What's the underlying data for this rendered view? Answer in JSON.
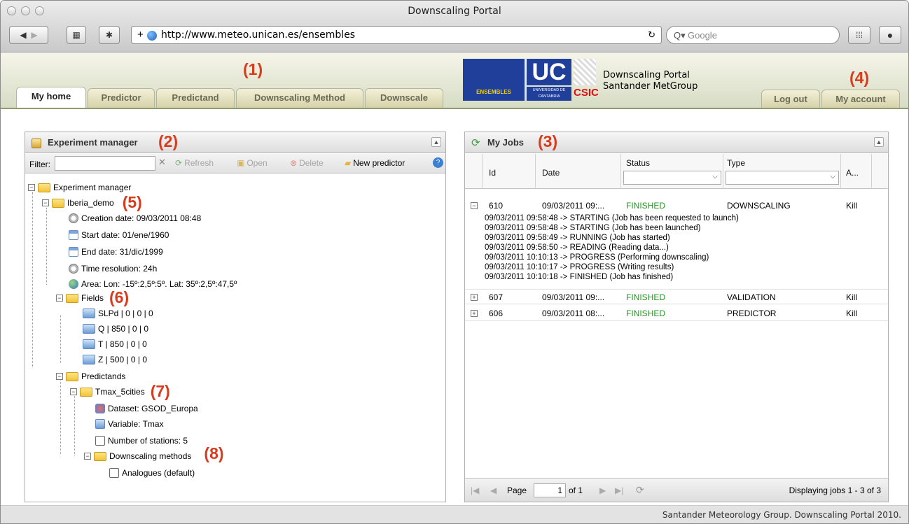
{
  "window": {
    "title": "Downscaling Portal"
  },
  "browser": {
    "url": "http://www.meteo.unican.es/ensembles",
    "search_placeholder": "Google"
  },
  "callouts": {
    "c1": "(1)",
    "c2": "(2)",
    "c3": "(3)",
    "c4": "(4)",
    "c5": "(5)",
    "c6": "(6)",
    "c7": "(7)",
    "c8": "(8)"
  },
  "nav": {
    "tabs": [
      "My home",
      "Predictor",
      "Predictand",
      "Downscaling Method",
      "Downscale"
    ],
    "right_tabs": [
      "Log out",
      "My account"
    ]
  },
  "logos": {
    "ensembles": "ENSEMBLES",
    "uc": "UC",
    "uc_sub": "UNIVERSIDAD DE CANTABRIA",
    "csic": "CSIC"
  },
  "brand": {
    "line1": "Downscaling Portal",
    "line2": "Santander MetGroup"
  },
  "experiment_manager": {
    "title": "Experiment manager",
    "filter_label": "Filter:",
    "refresh": "Refresh",
    "open": "Open",
    "delete": "Delete",
    "new_predictor": "New predictor",
    "tree": {
      "root": "Experiment manager",
      "iberia": "Iberia_demo",
      "creation": "Creation date: 09/03/2011 08:48",
      "start": "Start date: 01/ene/1960",
      "end": "End date: 31/dic/1999",
      "resolution": "Time resolution: 24h",
      "area": "Area: Lon: -15º:2,5º:5º. Lat: 35º:2,5º:47,5º",
      "fields": "Fields",
      "f1": "SLPd | 0 | 0 | 0",
      "f2": "Q | 850 | 0 | 0",
      "f3": "T | 850 | 0 | 0",
      "f4": "Z | 500 | 0 | 0",
      "predictands": "Predictands",
      "tmax": "Tmax_5cities",
      "dataset": "Dataset: GSOD_Europa",
      "variable": "Variable: Tmax",
      "stations": "Number of stations: 5",
      "methods": "Downscaling methods",
      "analogues": "Analogues (default)"
    }
  },
  "jobs": {
    "title": "My Jobs",
    "columns": [
      "Id",
      "Date",
      "Status",
      "Type",
      "A..."
    ],
    "rows": [
      {
        "id": "610",
        "date": "09/03/2011 09:...",
        "status": "FINISHED",
        "type": "DOWNSCALING",
        "action": "Kill"
      },
      {
        "id": "607",
        "date": "09/03/2011 09:...",
        "status": "FINISHED",
        "type": "VALIDATION",
        "action": "Kill"
      },
      {
        "id": "606",
        "date": "09/03/2011 08:...",
        "status": "FINISHED",
        "type": "PREDICTOR",
        "action": "Kill"
      }
    ],
    "log": "09/03/2011 09:58:48 -> STARTING (Job has been requested to launch)\n09/03/2011 09:58:48 -> STARTING (Job has been launched)\n09/03/2011 09:58:49 -> RUNNING (Job has started)\n09/03/2011 09:58:50 -> READING (Reading data...)\n09/03/2011 10:10:13 -> PROGRESS (Performing downscaling)\n09/03/2011 10:10:17 -> PROGRESS (Writing results)\n09/03/2011 10:10:18 -> FINISHED (Job has finished)",
    "pager": {
      "page_label": "Page",
      "page": "1",
      "of": "of 1",
      "display": "Displaying jobs 1 - 3 of 3"
    }
  },
  "footer": "Santander Meteorology Group. Downscaling Portal 2010."
}
